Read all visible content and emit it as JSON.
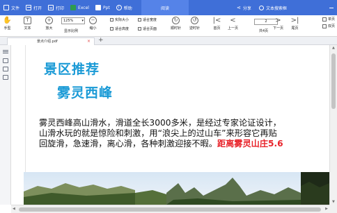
{
  "colors": {
    "menubar": "#3f6fd8",
    "accent_heading": "#1a9ad6",
    "highlight_red": "#e8232a"
  },
  "menubar": {
    "items": [
      {
        "label": "文件",
        "icon": "file-icon"
      },
      {
        "label": "打开",
        "icon": "folder-open-icon"
      },
      {
        "label": "打印",
        "icon": "printer-icon"
      },
      {
        "label": "Excel",
        "icon": "excel-icon"
      },
      {
        "label": "Ppt",
        "icon": "ppt-icon"
      },
      {
        "label": "帮助",
        "icon": "help-icon"
      }
    ],
    "read_tab": "阅读",
    "share": "分享",
    "search": "文本搜索框"
  },
  "toolbar": {
    "hand": "手型",
    "text": "文本",
    "zoom_in": "放大",
    "zoom_value": "125%",
    "zoom_caption": "显示比例",
    "zoom_out": "缩小",
    "actual_size": "实际大小",
    "fit_width": "适合宽度",
    "fit_height": "适合高度",
    "fit_page": "适合页面",
    "rotate_left": "顺时针",
    "rotate_right": "逆时针",
    "first_page": "首页",
    "prev_page": "上一页",
    "page_current": "2",
    "page_total": "共4页",
    "next_page": "下一页",
    "last_page": "尾页",
    "single_page": "单页",
    "double_page": "双页"
  },
  "tabs": [
    {
      "label": "景点介绍.pdf"
    }
  ],
  "document": {
    "heading1": "景区推荐",
    "heading2": "雾灵西峰",
    "line1": "雾灵西峰高山滑水，滑道全长3000多米，是经过专家论证设计，",
    "line2": "山滑水玩的就是惊险和刺激，用“浪尖上的过山车”来形容它再贴",
    "line3_plain": "回旋滑，急速滑，离心滑，各种刺激迎接不暇。",
    "line3_red": "距离雾灵山庄5.6"
  }
}
